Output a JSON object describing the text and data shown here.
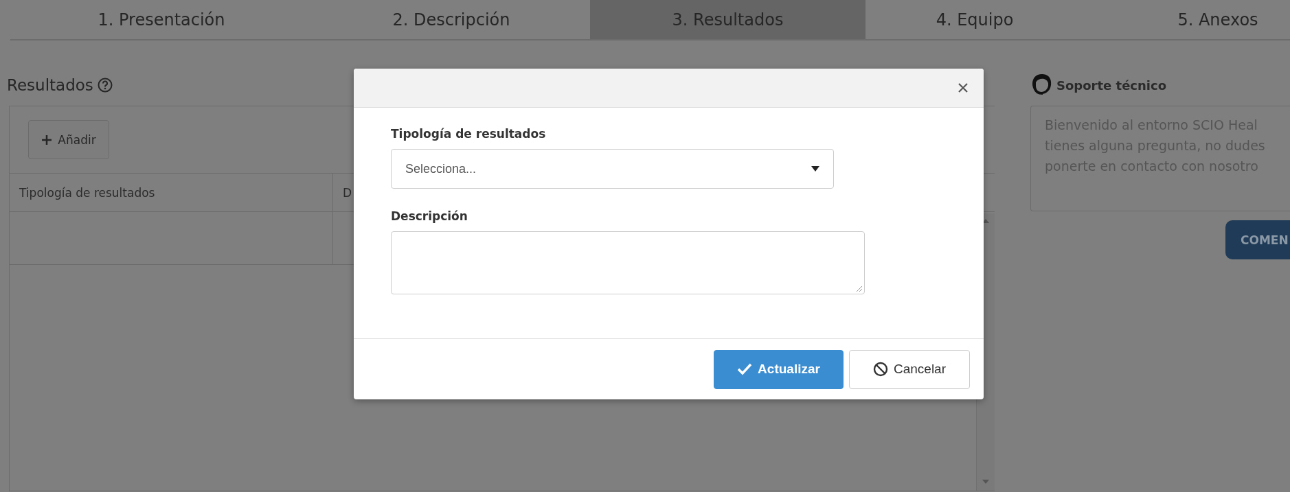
{
  "tabs": [
    {
      "label": "1. Presentación",
      "selected": false
    },
    {
      "label": "2. Descripción",
      "selected": false
    },
    {
      "label": "3. Resultados",
      "selected": true
    },
    {
      "label": "4. Equipo",
      "selected": false
    },
    {
      "label": "5. Anexos",
      "selected": false
    }
  ],
  "section": {
    "title": "Resultados",
    "add_button": "Añadir",
    "table": {
      "columns": [
        "Tipología de resultados",
        "D"
      ]
    }
  },
  "support": {
    "title": "Soporte técnico",
    "message_lines": [
      "Bienvenido al entorno SCIO Heal",
      "tienes alguna pregunta, no dudes",
      "ponerte en contacto con nosotro"
    ],
    "button": "COMEN"
  },
  "dialog": {
    "fields": [
      {
        "kind": "select",
        "label": "Tipología de resultados",
        "placeholder": "Selecciona..."
      },
      {
        "kind": "textarea",
        "label": "Descripción"
      }
    ],
    "buttons": [
      {
        "kind": "primary",
        "label": "Actualizar"
      },
      {
        "kind": "secondary",
        "label": "Cancelar"
      }
    ]
  }
}
